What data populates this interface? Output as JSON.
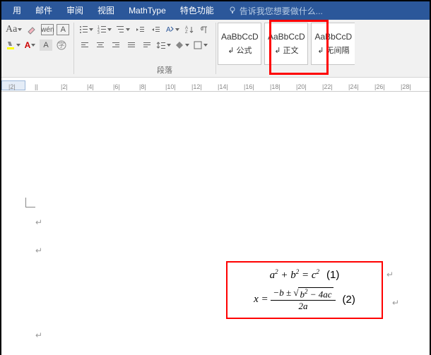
{
  "menubar": {
    "tabs": [
      "用",
      "邮件",
      "审阅",
      "视图",
      "MathType",
      "特色功能"
    ],
    "search_placeholder": "告诉我您想要做什么..."
  },
  "ribbon": {
    "paragraph_label": "段落",
    "styles": [
      {
        "preview": "AaBbCcD",
        "name": "公式"
      },
      {
        "preview": "AaBbCcD",
        "name": "正文"
      },
      {
        "preview": "AaBbCcD",
        "name": "无间隔"
      }
    ]
  },
  "ruler": {
    "marks": [
      "2",
      "",
      "2",
      "4",
      "6",
      "8",
      "10",
      "12",
      "14",
      "16",
      "18",
      "20",
      "22",
      "24",
      "26",
      "28"
    ]
  },
  "document": {
    "equations": [
      {
        "display": "a² + b² = c²",
        "num": "(1)"
      },
      {
        "display": "x = (−b ± √(b²−4ac)) / 2a",
        "num": "(2)"
      }
    ],
    "para_mark": "↵"
  }
}
